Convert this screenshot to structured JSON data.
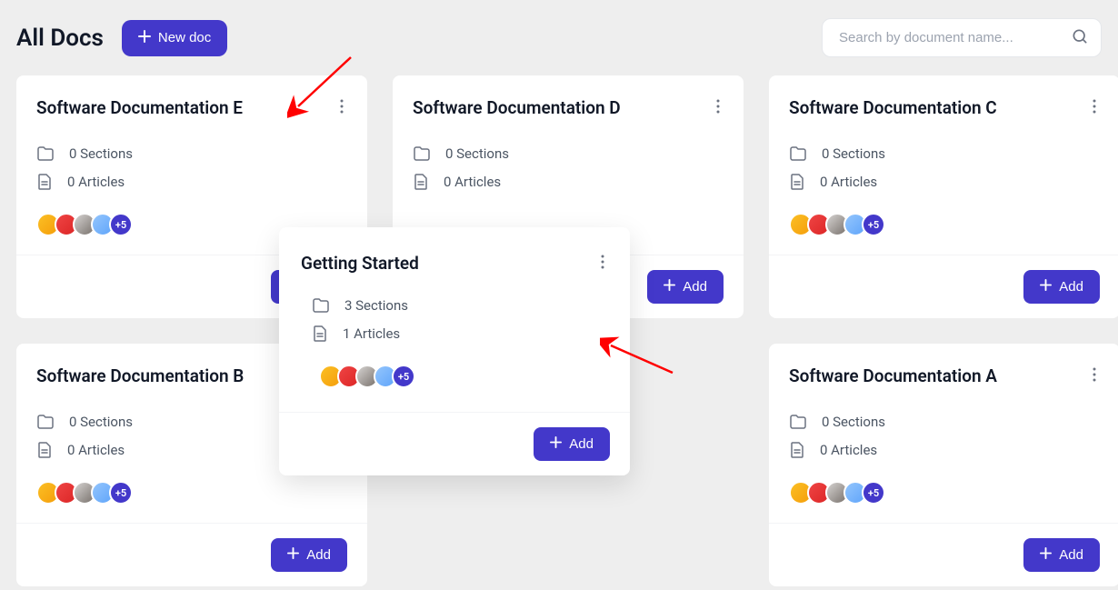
{
  "header": {
    "title": "All Docs",
    "new_doc_label": "New doc"
  },
  "search": {
    "placeholder": "Search by document name..."
  },
  "add_label": "Add",
  "avatar_more": "+5",
  "cards": [
    {
      "title": "Software Documentation E",
      "sections": "0 Sections",
      "articles": "0 Articles"
    },
    {
      "title": "Software Documentation D",
      "sections": "0 Sections",
      "articles": "0 Articles"
    },
    {
      "title": "Software Documentation C",
      "sections": "0 Sections",
      "articles": "0 Articles"
    },
    {
      "title": "Software Documentation B",
      "sections": "0 Sections",
      "articles": "0 Articles"
    },
    {
      "title": "",
      "sections": "",
      "articles": ""
    },
    {
      "title": "Software Documentation A",
      "sections": "0 Sections",
      "articles": "0 Articles"
    }
  ],
  "floating": {
    "title": "Getting Started",
    "sections": "3 Sections",
    "articles": "1 Articles"
  }
}
